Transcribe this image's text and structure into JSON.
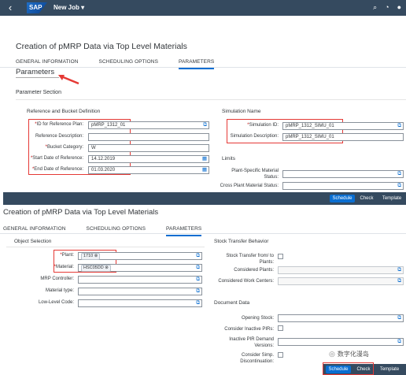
{
  "shell": {
    "back_icon": "back-arrow-icon",
    "logo": "SAP",
    "app_title": "New Job ▾"
  },
  "top": {
    "page_title": "Creation of pMRP Data via Top Level Materials",
    "tabs": [
      "GENERAL INFORMATION",
      "SCHEDULING OPTIONS",
      "PARAMETERS"
    ],
    "parameters_heading": "Parameters",
    "parameter_section": "Parameter Section",
    "ref_group": "Reference and Bucket Definition",
    "fields": {
      "id_ref_plan": {
        "label": "ID for Reference Plan:",
        "value": "pMRP_1312_01"
      },
      "ref_desc": {
        "label": "Reference Description:",
        "value": ""
      },
      "bucket_cat": {
        "label": "Bucket Category:",
        "value": "W"
      },
      "start_date": {
        "label": "Start Date of Reference:",
        "value": "14.12.2019"
      },
      "end_date": {
        "label": "End Date of Reference:",
        "value": "01.03.2020"
      }
    },
    "sim_group": "Simulation Name",
    "sim_id": {
      "label": "Simulation ID:",
      "value": "pMRP_1312_SIMU_01"
    },
    "sim_desc": {
      "label": "Simulation Description:",
      "value": "pMRP_1312_SIMU_01"
    },
    "limits_group": "Limits",
    "plant_status": {
      "label1": "Plant-Specific Material",
      "label2": "Status:"
    },
    "cross_plant": {
      "label": "Cross Plant Material Status:"
    },
    "buttons": {
      "schedule": "Schedule",
      "check": "Check",
      "template": "Template"
    }
  },
  "bottom": {
    "page_title": "Creation of pMRP Data via Top Level Materials",
    "tabs": [
      "GENERAL INFORMATION",
      "SCHEDULING OPTIONS",
      "PARAMETERS"
    ],
    "object_selection": "Object Selection",
    "plant": {
      "label": "Plant:",
      "value": "1710"
    },
    "material": {
      "label": "Material:",
      "value": "HSC05DD"
    },
    "mrp_controller": "MRP Controller:",
    "material_type": "Material type:",
    "low_level_code": "Low-Level Code:",
    "stock_transfer_group": "Stock Transfer Behavior",
    "stock_transfer": {
      "label1": "Stock Transfer from/ to",
      "label2": "Plants:"
    },
    "considered_plants": "Considered Plants:",
    "considered_wc": "Considered Work Centers:",
    "document_data": "Document Data",
    "opening_stock": "Opening Stock:",
    "consider_pirs": "Consider Inactive PIRs:",
    "inactive_pir": {
      "label1": "Inactive PIR Demand",
      "label2": "Versions:"
    },
    "consider_simp": {
      "label1": "Consider Simp.",
      "label2": "Discontinuation:"
    },
    "buttons": {
      "schedule": "Schedule",
      "check": "Check",
      "template": "Template"
    }
  },
  "watermark": "数字化漫岛",
  "colors": {
    "shell": "#354a5f",
    "accent": "#0a6ed1",
    "highlight": "#e53935"
  }
}
